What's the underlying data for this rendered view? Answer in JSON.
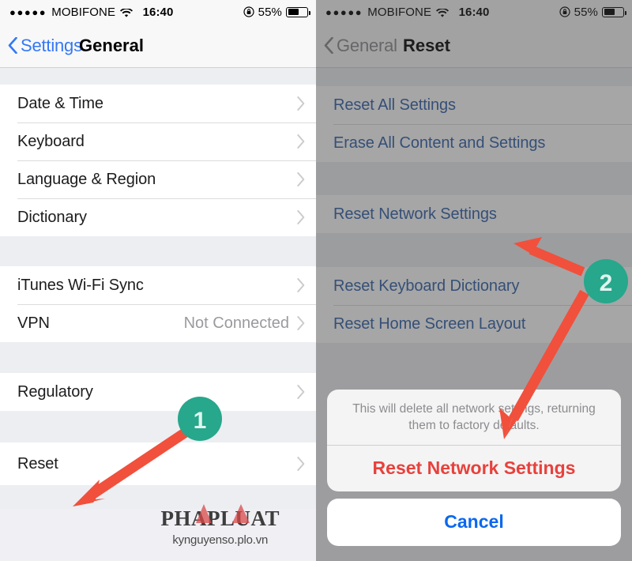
{
  "status_bar": {
    "signal_dots": "●●●●●",
    "carrier": "MOBIFONE",
    "wifi_icon": "wifi-icon",
    "time": "16:40",
    "orientation_lock_icon": "rotation-lock-icon",
    "battery_percent": "55%",
    "battery_level": 55
  },
  "left_pane": {
    "nav": {
      "back_icon": "chevron-left-icon",
      "back_label": "Settings",
      "title": "General"
    },
    "sections": [
      {
        "rows": [
          {
            "label": "Date & Time",
            "value": "",
            "chevron": true
          },
          {
            "label": "Keyboard",
            "value": "",
            "chevron": true
          },
          {
            "label": "Language & Region",
            "value": "",
            "chevron": true
          },
          {
            "label": "Dictionary",
            "value": "",
            "chevron": true
          }
        ]
      },
      {
        "rows": [
          {
            "label": "iTunes Wi-Fi Sync",
            "value": "",
            "chevron": true
          },
          {
            "label": "VPN",
            "value": "Not Connected",
            "chevron": true
          }
        ]
      },
      {
        "rows": [
          {
            "label": "Regulatory",
            "value": "",
            "chevron": true
          }
        ]
      },
      {
        "rows": [
          {
            "label": "Reset",
            "value": "",
            "chevron": true
          }
        ]
      }
    ]
  },
  "right_pane": {
    "nav": {
      "back_icon": "chevron-left-icon",
      "back_label": "General",
      "title": "Reset"
    },
    "sections": [
      {
        "rows": [
          {
            "label": "Reset All Settings"
          },
          {
            "label": "Erase All Content and Settings"
          }
        ]
      },
      {
        "rows": [
          {
            "label": "Reset Network Settings"
          }
        ]
      },
      {
        "rows": [
          {
            "label": "Reset Keyboard Dictionary"
          },
          {
            "label": "Reset Home Screen Layout"
          }
        ]
      }
    ],
    "action_sheet": {
      "message": "This will delete all network settings, returning them to factory defaults.",
      "destructive_label": "Reset Network Settings",
      "cancel_label": "Cancel"
    }
  },
  "watermark": {
    "main": "PHAPLUAT",
    "sub": "kynguyenso.plo.vn"
  },
  "annotations": {
    "badges": [
      {
        "number": "1"
      },
      {
        "number": "2"
      }
    ],
    "arrow_color": "#f1503c",
    "badge_color": "#27a78c"
  }
}
